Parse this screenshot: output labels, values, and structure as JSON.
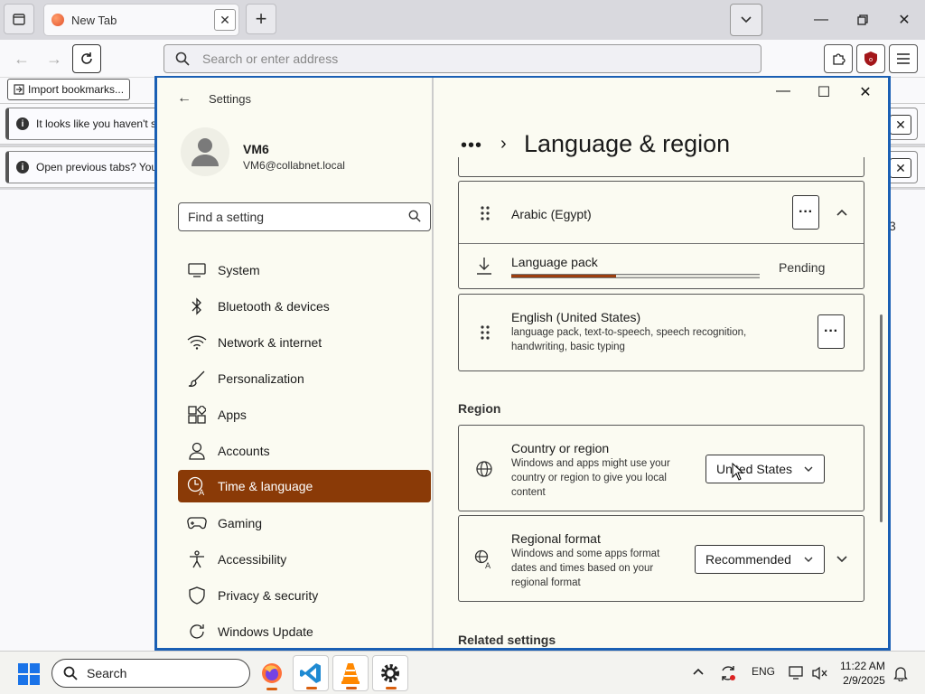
{
  "browser": {
    "tab_title": "New Tab",
    "address_placeholder": "Search or enter address",
    "import_bookmarks": "Import bookmarks...",
    "notice1": "It looks like you haven't s",
    "notice2": "Open previous tabs? You",
    "content_stub": "3"
  },
  "settings": {
    "app_title": "Settings",
    "user": {
      "name": "VM6",
      "email": "VM6@collabnet.local"
    },
    "search_placeholder": "Find a setting",
    "nav": [
      {
        "label": "System",
        "icon": "monitor-icon"
      },
      {
        "label": "Bluetooth & devices",
        "icon": "bluetooth-icon"
      },
      {
        "label": "Network & internet",
        "icon": "wifi-icon"
      },
      {
        "label": "Personalization",
        "icon": "brush-icon"
      },
      {
        "label": "Apps",
        "icon": "apps-icon"
      },
      {
        "label": "Accounts",
        "icon": "person-icon"
      },
      {
        "label": "Time & language",
        "icon": "time-language-icon",
        "active": true
      },
      {
        "label": "Gaming",
        "icon": "gamepad-icon"
      },
      {
        "label": "Accessibility",
        "icon": "accessibility-icon"
      },
      {
        "label": "Privacy & security",
        "icon": "shield-icon"
      },
      {
        "label": "Windows Update",
        "icon": "update-icon"
      }
    ],
    "breadcrumb_dots": "•••",
    "page_title": "Language & region",
    "languages": {
      "arabic": {
        "name": "Arabic (Egypt)"
      },
      "language_pack": {
        "label": "Language pack",
        "status": "Pending",
        "progress": 0.42
      },
      "english": {
        "name": "English (United States)",
        "features": "language pack, text-to-speech, speech recognition, handwriting, basic typing"
      }
    },
    "region": {
      "heading": "Region",
      "country": {
        "label": "Country or region",
        "desc": "Windows and apps might use your country or region to give you local content",
        "value": "United States"
      },
      "format": {
        "label": "Regional format",
        "desc": "Windows and some apps format dates and times based on your regional format",
        "value": "Recommended"
      }
    },
    "related_heading": "Related settings"
  },
  "taskbar": {
    "search_label": "Search",
    "tray_lang": "ENG",
    "time": "11:22 AM",
    "date": "2/9/2025"
  },
  "colors": {
    "accent": "#8a3a07",
    "window_border": "#1a5fb4",
    "progress": "#9c3e0e"
  }
}
